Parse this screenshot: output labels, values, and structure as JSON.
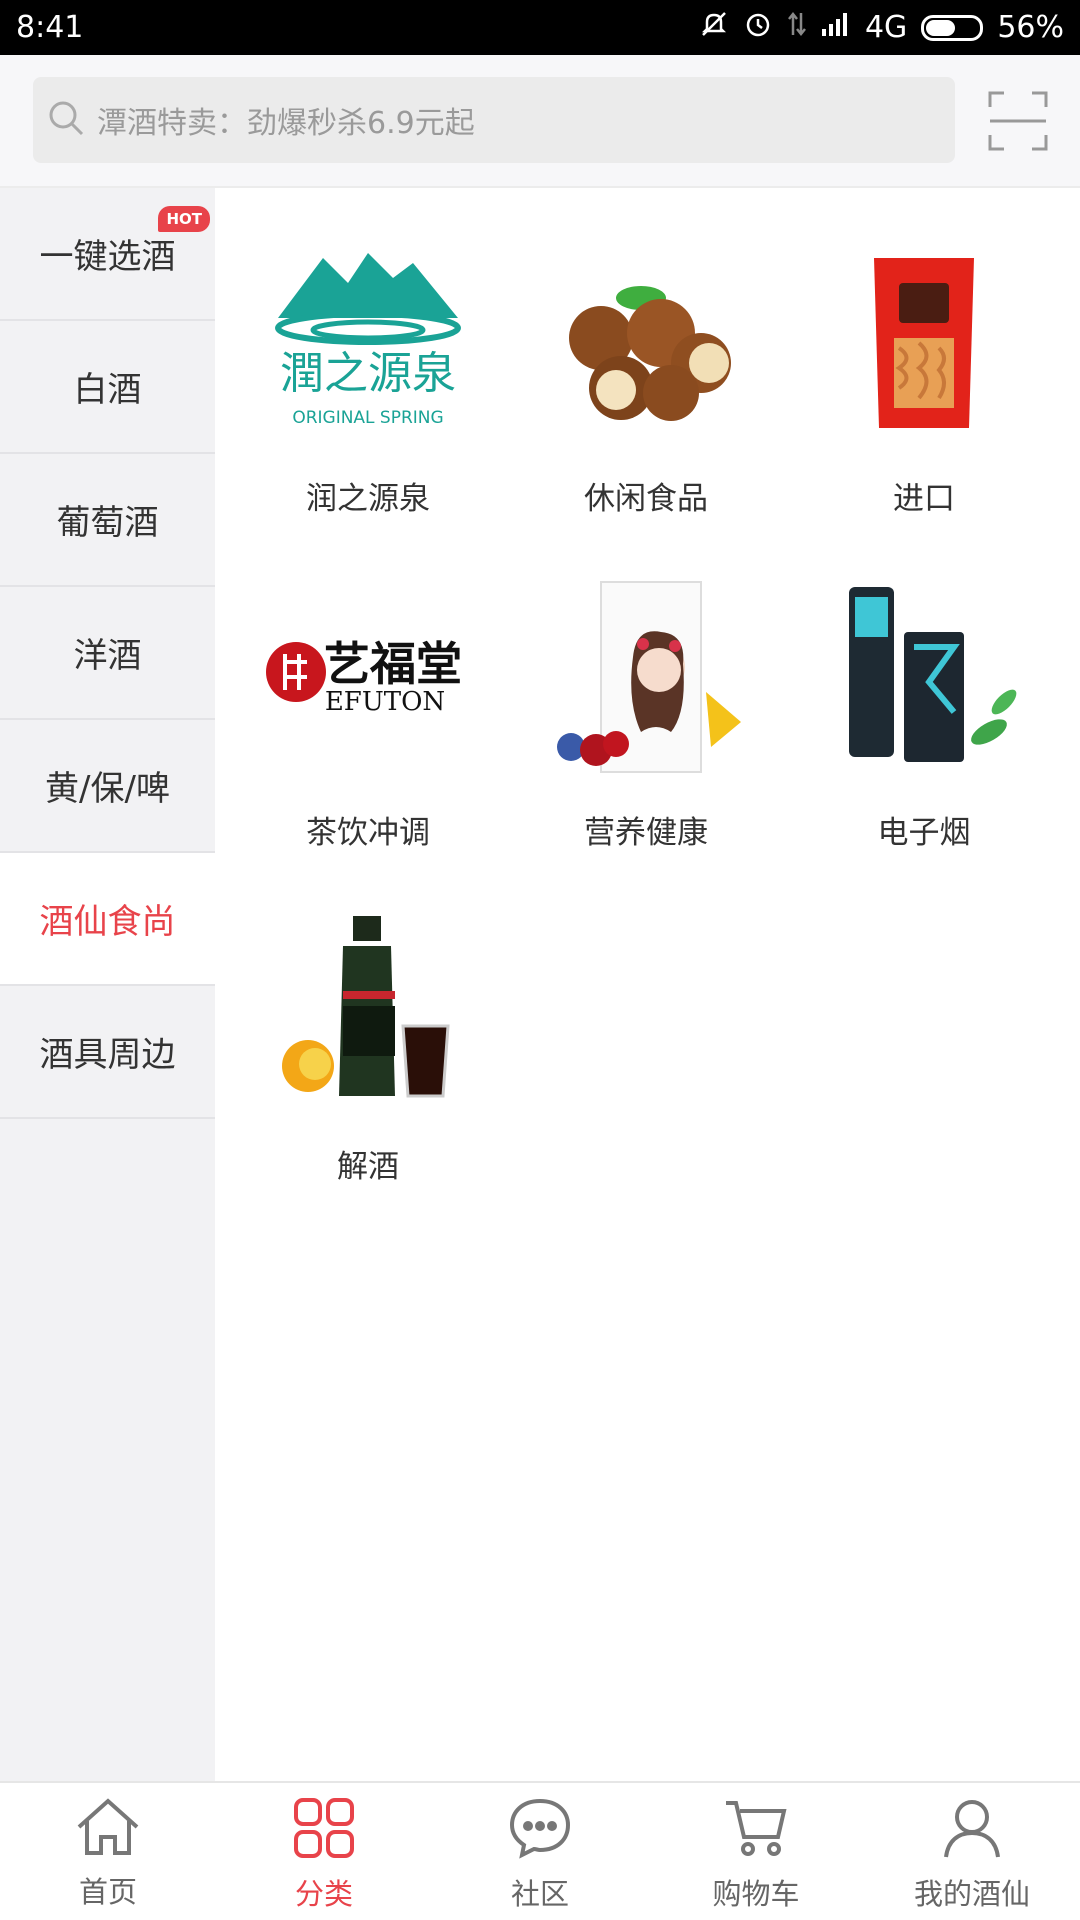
{
  "status": {
    "time": "8:41",
    "network": "4G",
    "battery": "56%",
    "battery_level": 0.56
  },
  "search": {
    "placeholder": "潭酒特卖：劲爆秒杀6.9元起"
  },
  "sidebar": {
    "items": [
      {
        "label": "一键选酒",
        "badge": "HOT"
      },
      {
        "label": "白酒"
      },
      {
        "label": "葡萄酒"
      },
      {
        "label": "洋酒"
      },
      {
        "label": "黄/保/啤"
      },
      {
        "label": "酒仙食尚",
        "active": true
      },
      {
        "label": "酒具周边"
      }
    ]
  },
  "categories": [
    {
      "label": "润之源泉",
      "logo_text": "潤之源泉",
      "logo_sub": "ORIGINAL SPRING"
    },
    {
      "label": "休闲食品"
    },
    {
      "label": "进口"
    },
    {
      "label": "茶饮冲调",
      "logo_text": "艺福堂",
      "logo_sub": "EFUTON"
    },
    {
      "label": "营养健康"
    },
    {
      "label": "电子烟"
    },
    {
      "label": "解酒"
    }
  ],
  "tabbar": {
    "items": [
      {
        "label": "首页",
        "icon": "home-icon"
      },
      {
        "label": "分类",
        "icon": "category-icon",
        "active": true
      },
      {
        "label": "社区",
        "icon": "chat-icon"
      },
      {
        "label": "购物车",
        "icon": "cart-icon"
      },
      {
        "label": "我的酒仙",
        "icon": "user-icon"
      }
    ]
  },
  "colors": {
    "accent": "#e8434a",
    "sidebar_bg": "#f2f2f4"
  }
}
